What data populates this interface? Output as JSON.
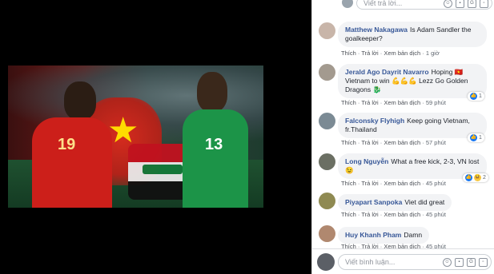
{
  "photo": {
    "left_jersey": "19",
    "right_jersey": "13"
  },
  "top_input": {
    "placeholder": "Viết trả lời..."
  },
  "icons": [
    "emoji-icon",
    "camera-icon",
    "gif-icon",
    "sticker-icon"
  ],
  "action_labels": {
    "like": "Thích",
    "reply": "Trả lời",
    "translate": "Xem bản dịch",
    "sep": "·"
  },
  "comments": [
    {
      "name": "Matthew Nakagawa",
      "text": "Is Adam Sandler the goalkeeper?",
      "time": "1 giờ",
      "reactions": ""
    },
    {
      "name": "Jerald Ago Dayrit Navarro",
      "text": "Hoping 🇻🇳 Vietnam to win 💪💪💪 Lezz Go Golden Dragons 🐉",
      "time": "59 phút",
      "reactions": "1"
    },
    {
      "name": "Falconsky Flyhigh",
      "text": "Keep going Vietnam, fr.Thailand",
      "time": "57 phút",
      "reactions": "1"
    },
    {
      "name": "Long Nguyễn",
      "text": "What a free kick, 2-3, VN lost 😉",
      "time": "45 phút",
      "reactions": "2"
    },
    {
      "name": "Piyapart Sanpoka",
      "text": "Viet did great",
      "time": "45 phút",
      "reactions": ""
    },
    {
      "name": "Huy Khanh Pham",
      "text": "Damn",
      "time": "45 phút",
      "reactions": ""
    }
  ],
  "bottom_input": {
    "placeholder": "Viết bình luận..."
  },
  "colors": {
    "name": "#385898",
    "bubble": "#f2f3f5",
    "like": "#1877f2"
  }
}
